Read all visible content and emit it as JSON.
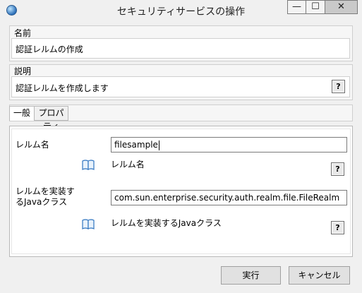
{
  "window": {
    "title": "セキュリティサービスの操作",
    "minimize": "—",
    "maximize": "☐",
    "close": "✕"
  },
  "name_section": {
    "label": "名前",
    "value": "認証レルムの作成"
  },
  "description_section": {
    "label": "説明",
    "value": "認証レルムを作成します",
    "help": "?"
  },
  "tabs": [
    {
      "label": "一般"
    },
    {
      "label": "プロパティ"
    }
  ],
  "form": {
    "realm_name": {
      "label": "レルム名",
      "value": "filesample",
      "hint": "レルム名",
      "help": "?"
    },
    "java_class": {
      "label_line1": "レルムを実装す",
      "label_line2": "るJavaクラス",
      "value": "com.sun.enterprise.security.auth.realm.file.FileRealm",
      "hint": "レルムを実装するJavaクラス",
      "help": "?"
    }
  },
  "buttons": {
    "execute": "実行",
    "cancel": "キャンセル"
  },
  "icons": {
    "app": "app-icon",
    "book": "book-icon"
  },
  "colors": {
    "close_button": "#c9c9c9",
    "book_icon": "#2f74c0"
  }
}
